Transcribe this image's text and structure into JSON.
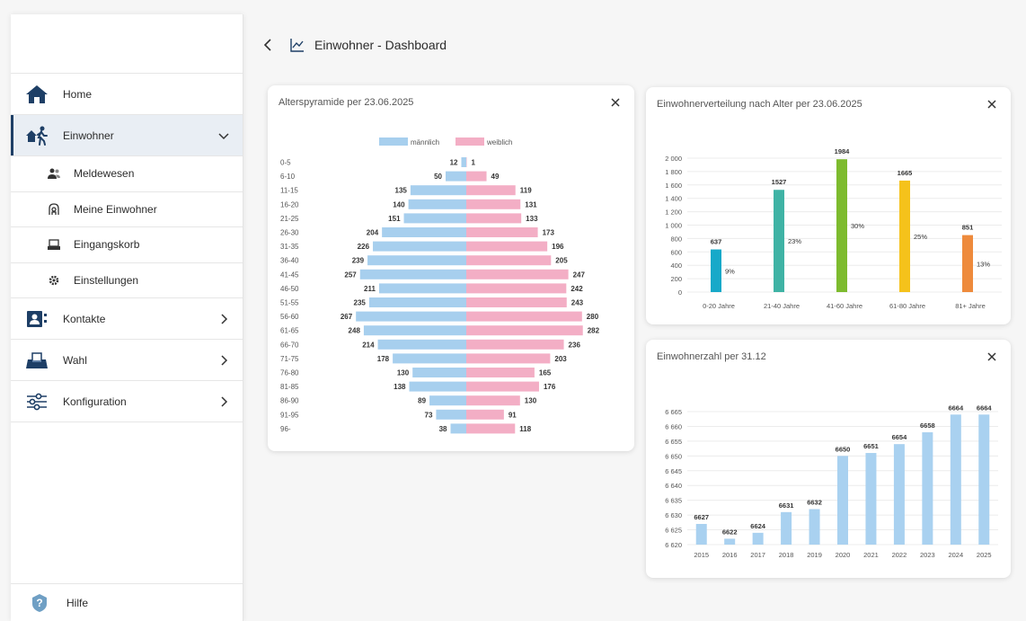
{
  "sidebar": {
    "nav": [
      {
        "label": "Home",
        "icon": "home-icon"
      },
      {
        "label": "Einwohner",
        "icon": "resident-walking-icon"
      },
      {
        "label": "Kontakte",
        "icon": "contacts-card-icon"
      },
      {
        "label": "Wahl",
        "icon": "ballot-box-icon"
      },
      {
        "label": "Konfiguration",
        "icon": "sliders-icon"
      }
    ],
    "sub": [
      {
        "label": "Meldewesen",
        "icon": "people-icon"
      },
      {
        "label": "Meine Einwohner",
        "icon": "person-outline-icon"
      },
      {
        "label": "Eingangskorb",
        "icon": "inbox-tray-icon"
      },
      {
        "label": "Einstellungen",
        "icon": "gear-icon"
      }
    ],
    "help": {
      "label": "Hilfe",
      "icon": "help-icon"
    }
  },
  "header": {
    "title": "Einwohner - Dashboard"
  },
  "colors": {
    "accent": "#1e3f66",
    "male": "#a7cfee",
    "female": "#f3aec5",
    "bar_blue": "#a9d1f0",
    "active_bg": "#e9eef4"
  },
  "cards": {
    "pyramid": {
      "title": "Alterspyramide per 23.06.2025"
    },
    "age": {
      "title": "Einwohnerverteilung nach Alter per 23.06.2025"
    },
    "population": {
      "title": "Einwohnerzahl per 31.12"
    }
  },
  "chart_data": [
    {
      "type": "bar",
      "orientation": "horizontal-pyramid",
      "categories": [
        "0-5",
        "6-10",
        "11-15",
        "16-20",
        "21-25",
        "26-30",
        "31-35",
        "36-40",
        "41-45",
        "46-50",
        "51-55",
        "56-60",
        "61-65",
        "66-70",
        "71-75",
        "76-80",
        "81-85",
        "86-90",
        "91-95",
        "96-"
      ],
      "series": [
        {
          "name": "männlich",
          "values": [
            12,
            50,
            135,
            140,
            151,
            204,
            226,
            239,
            257,
            211,
            235,
            267,
            248,
            214,
            178,
            130,
            138,
            89,
            73,
            38
          ]
        },
        {
          "name": "weiblich",
          "values": [
            1,
            49,
            119,
            131,
            133,
            173,
            196,
            205,
            247,
            242,
            243,
            280,
            282,
            236,
            203,
            165,
            176,
            130,
            91,
            118
          ]
        }
      ],
      "xlim": [
        0,
        300
      ],
      "legend": "top"
    },
    {
      "type": "bar",
      "categories": [
        "0-20 Jahre",
        "21-40 Jahre",
        "41-60 Jahre",
        "61-80 Jahre",
        "81+ Jahre"
      ],
      "values": [
        637,
        1527,
        1984,
        1665,
        851
      ],
      "percent_labels": [
        "9%",
        "23%",
        "30%",
        "25%",
        "13%"
      ],
      "colors": [
        "#17a9c9",
        "#3fb3a5",
        "#7dbb2e",
        "#f5c21b",
        "#ee8a3c"
      ],
      "yticks": [
        "0",
        "200",
        "400",
        "600",
        "800",
        "1 000",
        "1 200",
        "1 400",
        "1 600",
        "1 800",
        "2 000"
      ],
      "ylim": [
        0,
        2000
      ],
      "grid": true
    },
    {
      "type": "bar",
      "categories": [
        "2015",
        "2016",
        "2017",
        "2018",
        "2019",
        "2020",
        "2021",
        "2022",
        "2023",
        "2024",
        "2025"
      ],
      "values": [
        6627,
        6622,
        6624,
        6631,
        6632,
        6650,
        6651,
        6654,
        6658,
        6664,
        6664
      ],
      "yticks": [
        "6 620",
        "6 625",
        "6 630",
        "6 635",
        "6 640",
        "6 645",
        "6 650",
        "6 655",
        "6 660",
        "6 665"
      ],
      "ylim": [
        6620,
        6665
      ],
      "grid": true
    }
  ]
}
